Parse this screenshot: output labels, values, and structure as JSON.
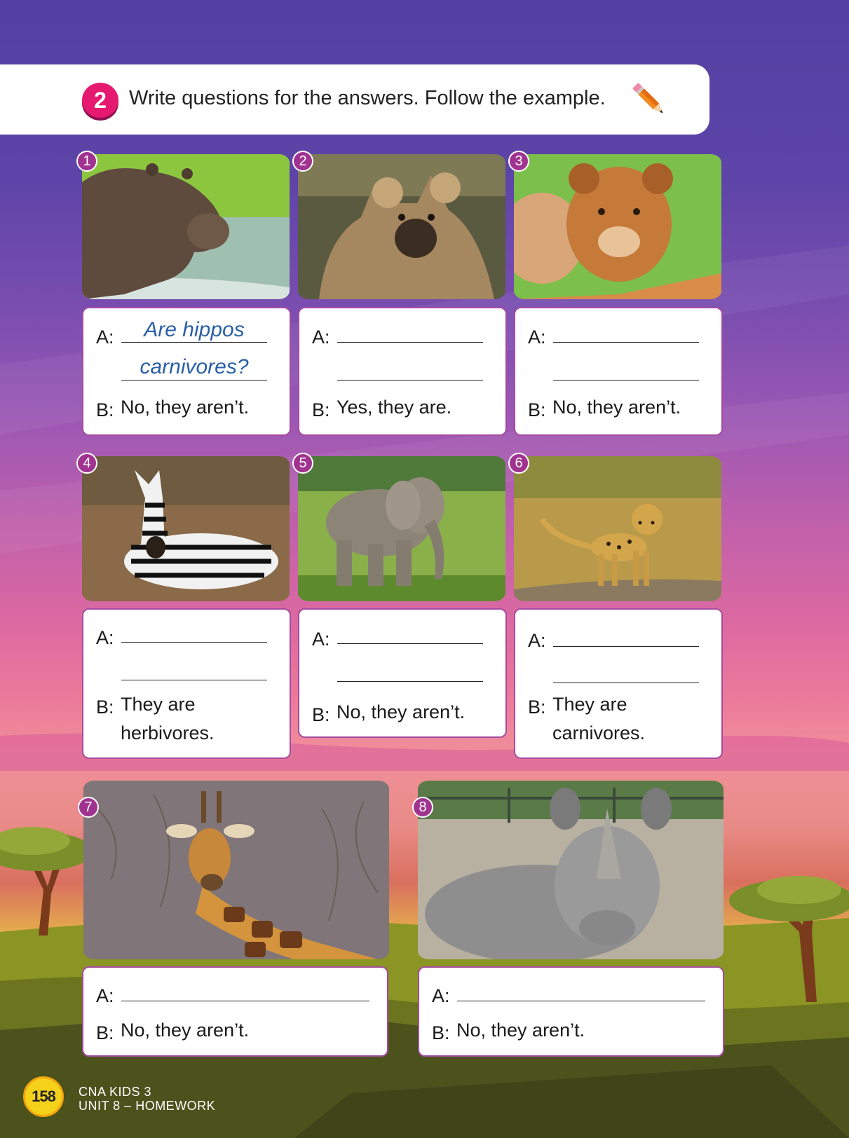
{
  "exercise": {
    "number": "2",
    "instruction": "Write questions for the answers. Follow the example."
  },
  "items": [
    {
      "num": "1",
      "animal": "hippo",
      "a_label": "A:",
      "b_label": "B:",
      "answer_line1": "Are hippos",
      "answer_line2": "carnivores?",
      "b_line1": "No, they aren’t.",
      "b_line2": ""
    },
    {
      "num": "2",
      "animal": "hyena",
      "a_label": "A:",
      "b_label": "B:",
      "b_line1": "Yes, they are.",
      "b_line2": ""
    },
    {
      "num": "3",
      "animal": "lion cub",
      "a_label": "A:",
      "b_label": "B:",
      "b_line1": "No, they aren’t.",
      "b_line2": ""
    },
    {
      "num": "4",
      "animal": "zebra",
      "a_label": "A:",
      "b_label": "B:",
      "b_line1": "They are",
      "b_line2": "herbivores."
    },
    {
      "num": "5",
      "animal": "elephant",
      "a_label": "A:",
      "b_label": "B:",
      "b_line1": "No, they aren’t.",
      "b_line2": ""
    },
    {
      "num": "6",
      "animal": "cheetah cub",
      "a_label": "A:",
      "b_label": "B:",
      "b_line1": "They are",
      "b_line2": "carnivores."
    },
    {
      "num": "7",
      "animal": "giraffe",
      "a_label": "A:",
      "b_label": "B:",
      "b_line1": "No, they aren’t.",
      "b_line2": ""
    },
    {
      "num": "8",
      "animal": "rhino",
      "a_label": "A:",
      "b_label": "B:",
      "b_line1": "No, they aren’t.",
      "b_line2": ""
    }
  ],
  "footer": {
    "page_number": "158",
    "book": "CNA KIDS 3",
    "unit": "UNIT 8 – HOMEWORK"
  },
  "colors": {
    "exercise_badge": "#e4196f",
    "number_badge": "#a0338f",
    "card_border": "#a64aa0",
    "example_answer": "#2a5fa8",
    "page_badge": "#f5d21a"
  }
}
